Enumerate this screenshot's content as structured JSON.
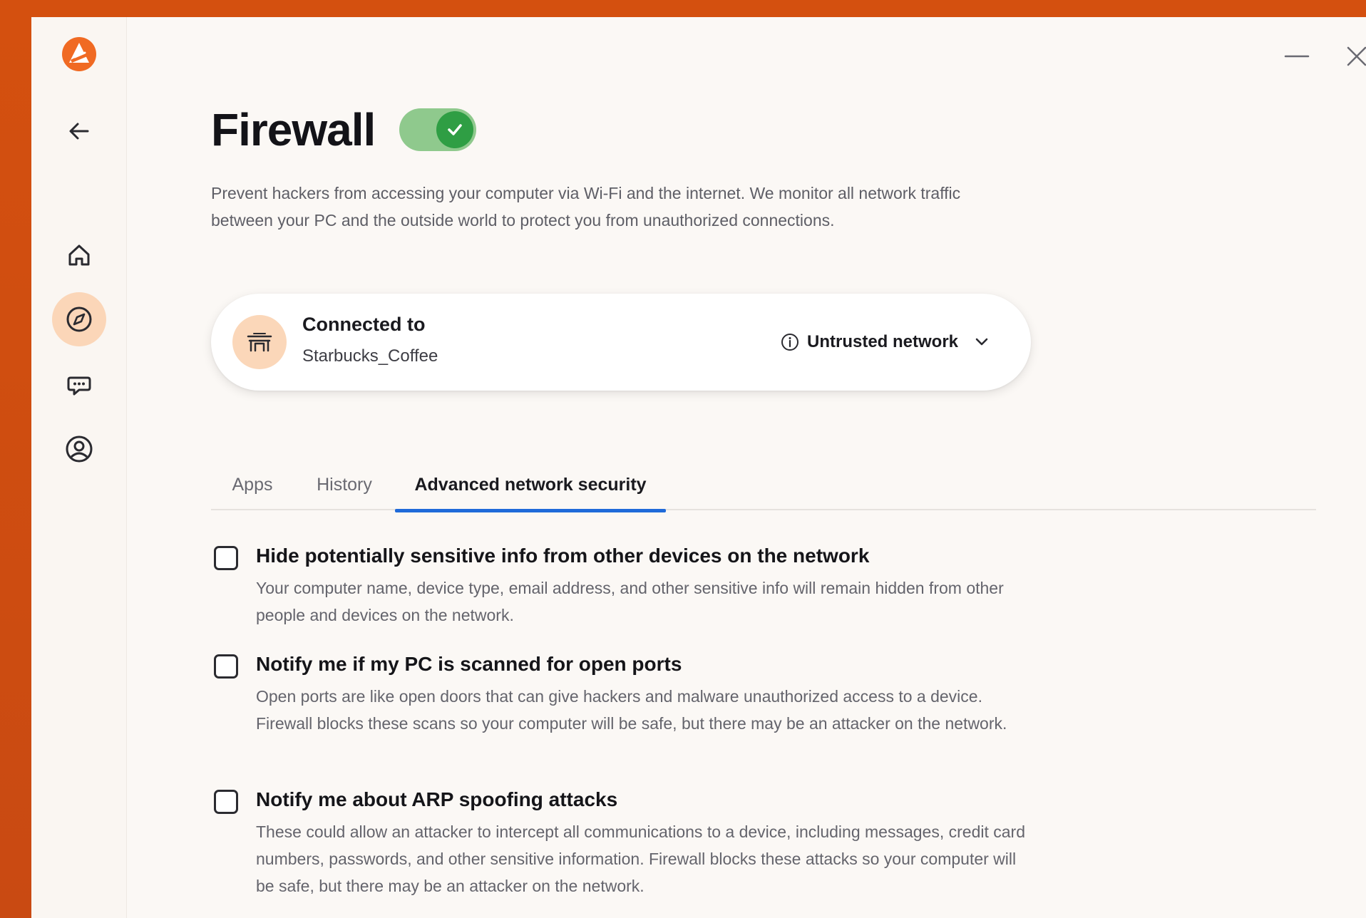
{
  "window": {
    "title": "Firewall",
    "firewall_enabled": true,
    "description": "Prevent hackers from accessing your computer via Wi-Fi and the internet. We monitor all network traffic between your PC and the outside world to protect you from unauthorized connections."
  },
  "colors": {
    "brand": "#d4500f",
    "accent_tab": "#1f6ad9",
    "toggle_on": "#2f9e44",
    "active_nav_bg": "#fbd6b8"
  },
  "sidebar": {
    "items": [
      {
        "icon": "logo-icon"
      },
      {
        "icon": "back-arrow-icon"
      },
      {
        "icon": "home-icon"
      },
      {
        "icon": "compass-icon",
        "active": true
      },
      {
        "icon": "chat-icon"
      },
      {
        "icon": "account-icon"
      }
    ]
  },
  "connection": {
    "label": "Connected to",
    "ssid": "Starbucks_Coffee",
    "icon": "cafe-icon",
    "status": "Untrusted network",
    "status_icon": "info-icon"
  },
  "tabs": [
    {
      "label": "Apps"
    },
    {
      "label": "History"
    },
    {
      "label": "Advanced network security",
      "active": true
    }
  ],
  "options": [
    {
      "title": "Hide potentially sensitive info from other devices on the network",
      "description": "Your computer name, device type, email address, and other sensitive info will remain hidden from other people and devices on the network.",
      "checked": false
    },
    {
      "title": "Notify me if my PC is scanned for open ports",
      "description": "Open ports are like open doors that can give hackers and malware unauthorized access to a device. Firewall blocks these scans so your computer will be safe, but there may be an attacker on the network.",
      "checked": false
    },
    {
      "title": "Notify me about ARP spoofing attacks",
      "description": "These could allow an attacker to intercept all communications to a device, including messages, credit card numbers, passwords, and other sensitive information. Firewall blocks these attacks so your computer will be safe, but there may be an attacker on the network.",
      "checked": false
    }
  ]
}
